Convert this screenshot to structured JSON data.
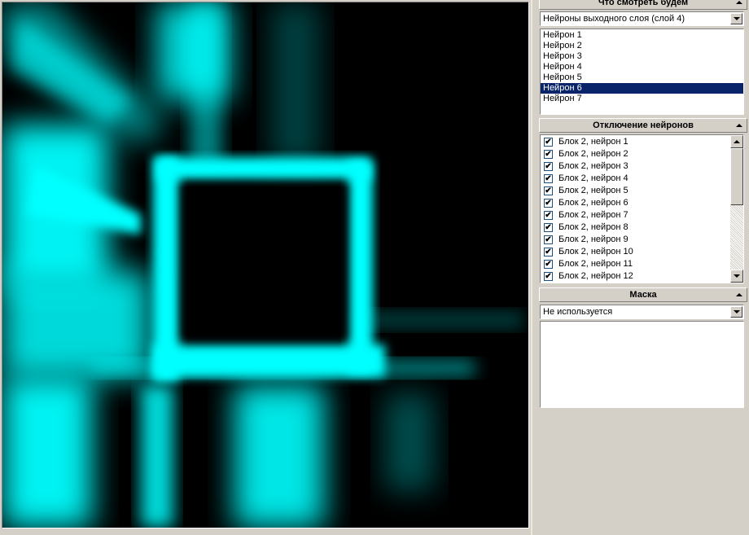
{
  "viewer": {
    "colors": {
      "glow": "#00ffff",
      "background": "#000000"
    }
  },
  "section_view": {
    "title": "Что смотреть будем",
    "layer_select": {
      "value": "Нейроны выходного слоя (слой 4)"
    },
    "neurons": [
      {
        "label": "Нейрон 1",
        "selected": false
      },
      {
        "label": "Нейрон 2",
        "selected": false
      },
      {
        "label": "Нейрон 3",
        "selected": false
      },
      {
        "label": "Нейрон 4",
        "selected": false
      },
      {
        "label": "Нейрон 5",
        "selected": false
      },
      {
        "label": "Нейрон 6",
        "selected": true
      },
      {
        "label": "Нейрон 7",
        "selected": false
      }
    ]
  },
  "section_disable": {
    "title": "Отключение нейронов",
    "items": [
      {
        "label": "Блок 2, нейрон 1",
        "checked": true
      },
      {
        "label": "Блок 2, нейрон 2",
        "checked": true
      },
      {
        "label": "Блок 2, нейрон 3",
        "checked": true
      },
      {
        "label": "Блок 2, нейрон 4",
        "checked": true
      },
      {
        "label": "Блок 2, нейрон 5",
        "checked": true
      },
      {
        "label": "Блок 2, нейрон 6",
        "checked": true
      },
      {
        "label": "Блок 2, нейрон 7",
        "checked": true
      },
      {
        "label": "Блок 2, нейрон 8",
        "checked": true
      },
      {
        "label": "Блок 2, нейрон 9",
        "checked": true
      },
      {
        "label": "Блок 2, нейрон 10",
        "checked": true
      },
      {
        "label": "Блок 2, нейрон 11",
        "checked": true
      },
      {
        "label": "Блок 2, нейрон 12",
        "checked": true
      }
    ],
    "check_mark": "✔"
  },
  "section_mask": {
    "title": "Маска",
    "mask_select": {
      "value": "Не используется"
    }
  },
  "colors": {
    "panel_bg": "#d4d0c8",
    "selection": "#0a246a"
  }
}
